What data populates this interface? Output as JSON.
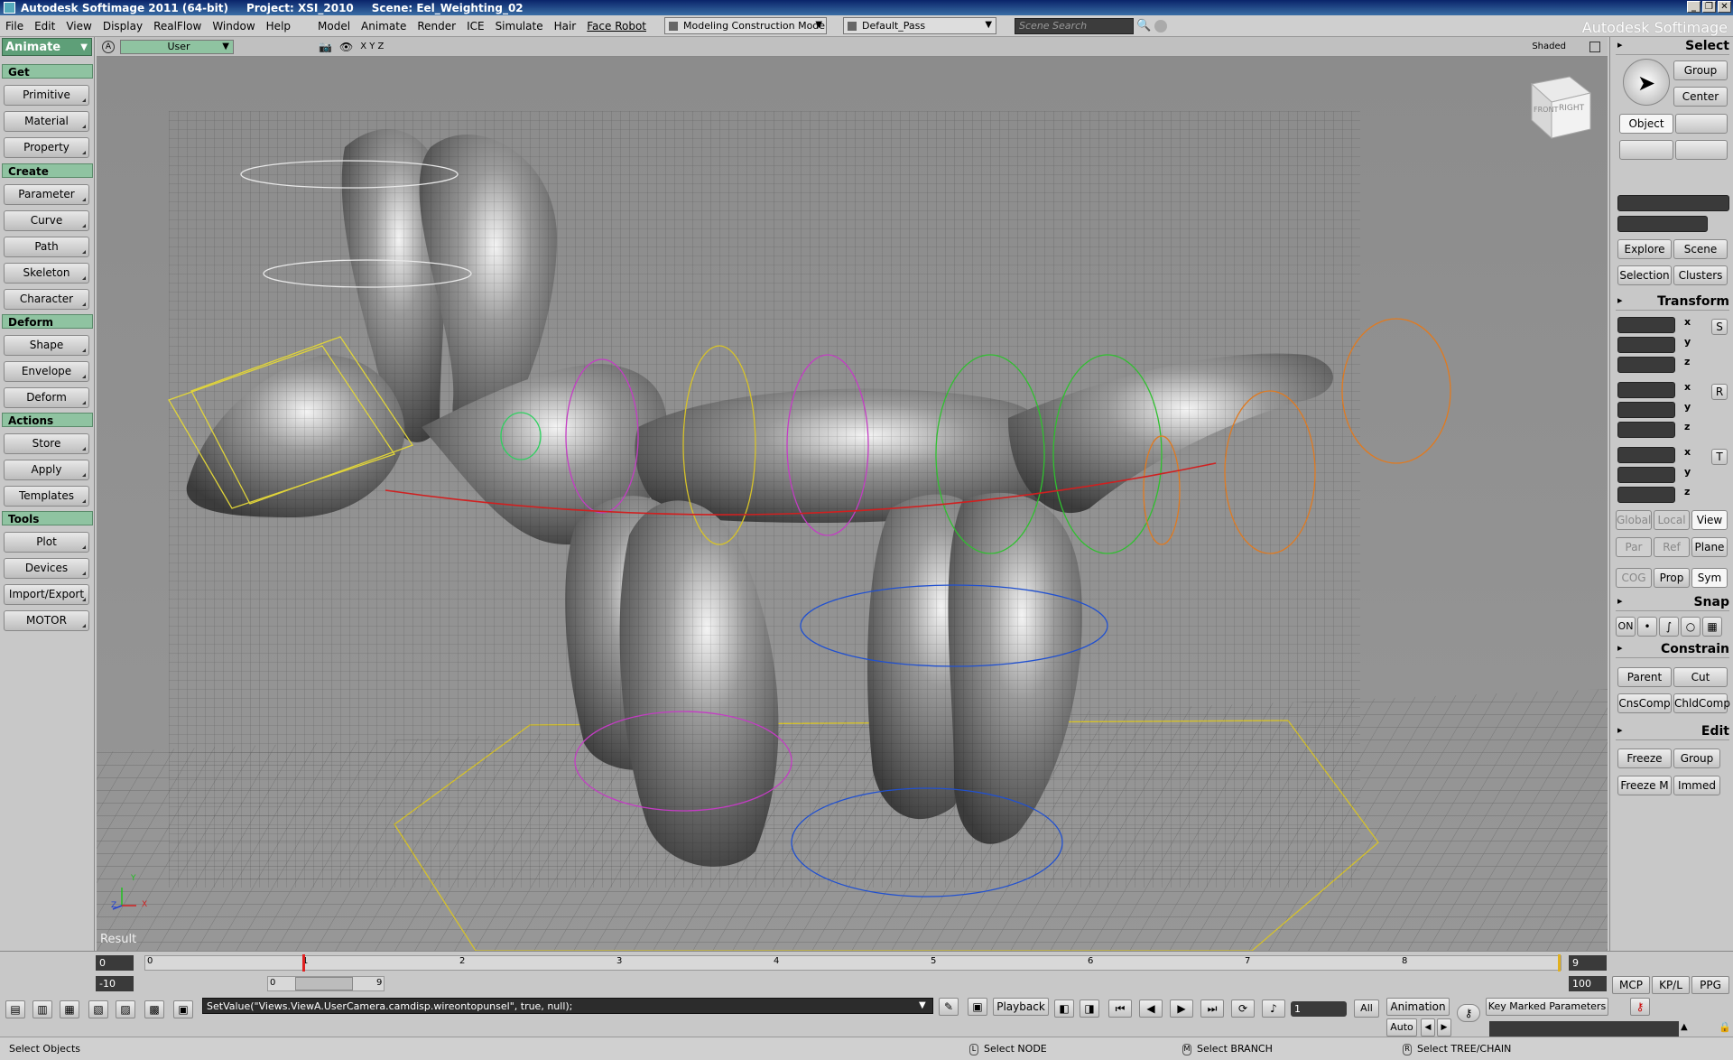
{
  "window": {
    "title": "Autodesk Softimage 2011 (64-bit)",
    "project": "Project: XSI_2010",
    "scene": "Scene: Eel_Weighting_02",
    "controls": [
      "_",
      "❐",
      "✕"
    ]
  },
  "menus": [
    "File",
    "Edit",
    "View",
    "Display",
    "RealFlow",
    "Window",
    "Help",
    "Model",
    "Animate",
    "Render",
    "ICE",
    "Simulate",
    "Hair",
    "Face Robot"
  ],
  "toolbar": {
    "construction_mode": "Modeling Construction Mode",
    "pass": "Default_Pass",
    "search_placeholder": "Scene Search",
    "brand": "Autodesk Softimage"
  },
  "left_panel": {
    "mode": "Animate",
    "sections": [
      {
        "title": "Get",
        "buttons": [
          "Primitive",
          "Material",
          "Property"
        ]
      },
      {
        "title": "Create",
        "buttons": [
          "Parameter",
          "Curve",
          "Path",
          "Skeleton",
          "Character"
        ]
      },
      {
        "title": "Deform",
        "buttons": [
          "Shape",
          "Envelope",
          "Deform"
        ]
      },
      {
        "title": "Actions",
        "buttons": [
          "Store",
          "Apply",
          "Templates"
        ]
      },
      {
        "title": "Tools",
        "buttons": [
          "Plot",
          "Devices",
          "Import/Export",
          "MOTOR"
        ]
      }
    ]
  },
  "viewport": {
    "letter": "A",
    "camera": "User",
    "axes": "X Y Z",
    "display_mode": "Shaded",
    "cube_front": "FRONT",
    "cube_right": "RIGHT",
    "result_label": "Result",
    "axis_x": "X",
    "axis_y": "Y",
    "axis_z": "Z"
  },
  "right_panel": {
    "select_title": "Select",
    "select_buttons": [
      "Group",
      "Center",
      "Object"
    ],
    "explore_buttons": [
      "Explore",
      "Scene",
      "Selection",
      "Clusters"
    ],
    "transform_title": "Transform",
    "transform_axes": [
      "x",
      "y",
      "z"
    ],
    "transform_icons": [
      "S",
      "R",
      "T"
    ],
    "ref_buttons": [
      "Global",
      "Local",
      "View",
      "Par",
      "Ref",
      "Plane",
      "COG",
      "Prop",
      "Sym"
    ],
    "snap_title": "Snap",
    "snap_on": "ON",
    "constrain_title": "Constrain",
    "constrain_buttons": [
      "Parent",
      "Cut",
      "CnsComp",
      "ChldComp"
    ],
    "edit_title": "Edit",
    "edit_buttons": [
      "Freeze",
      "Group",
      "Freeze M",
      "Immed"
    ]
  },
  "timeline": {
    "start": "0",
    "start2": "-10",
    "end": "9",
    "end2": "100",
    "ticks": [
      "0",
      "1",
      "2",
      "3",
      "4",
      "5",
      "6",
      "7",
      "8"
    ],
    "current_frame": "1",
    "range_start": "0",
    "range_end": "9",
    "tabs": [
      "MCP",
      "KP/L",
      "PPG"
    ],
    "playback": "Playback",
    "frame_field": "1",
    "all_label": "All",
    "animation_label": "Animation",
    "auto_label": "Auto",
    "key_marked": "Key Marked Parameters"
  },
  "command_line": "SetValue(\"Views.ViewA.UserCamera.camdisp.wireontopunsel\", true, null);",
  "status": {
    "left": "Select Objects",
    "l_label": "L",
    "l_text": "Select NODE",
    "m_label": "M",
    "m_text": "Select BRANCH",
    "r_label": "R",
    "r_text": "Select TREE/CHAIN"
  }
}
